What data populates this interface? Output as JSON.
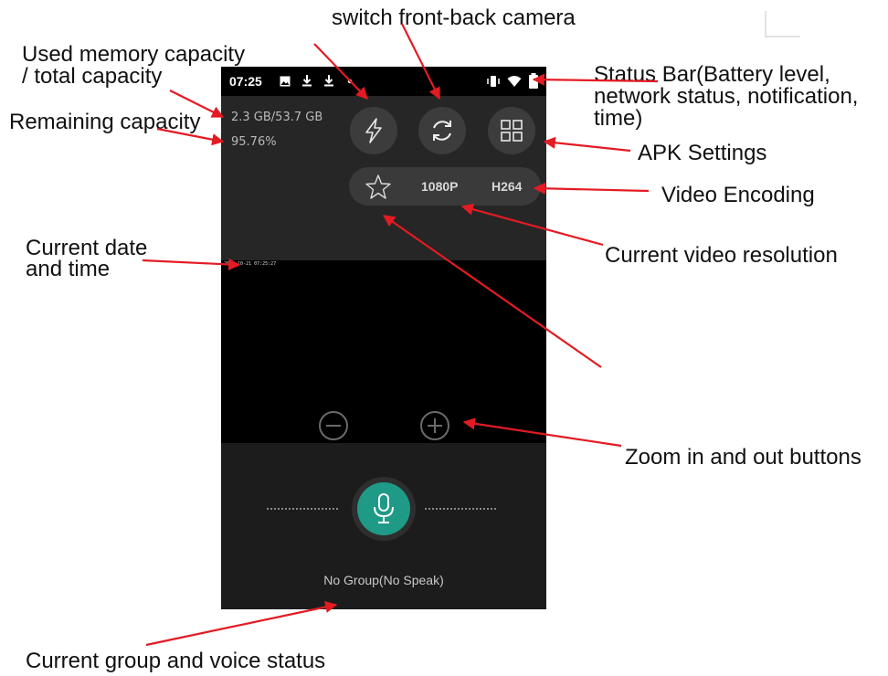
{
  "callouts": {
    "switch_camera": "switch front-back camera",
    "memory_line1": "Used memory capacity",
    "memory_line2": "/ total capacity",
    "remaining": "Remaining capacity",
    "status_line1": "Status Bar(Battery level,",
    "status_line2": "network status, notification,",
    "status_line3": " time)",
    "apk_settings": "APK Settings",
    "video_encoding": "Video Encoding",
    "date_line1": "Current date",
    "date_line2": "and time",
    "resolution": "Current video resolution",
    "zoom": "Zoom in and out buttons",
    "group_voice": "Current group and voice status"
  },
  "phone": {
    "status_time": "07:25",
    "memory_used_total": "2.3 GB/53.7 GB",
    "remaining_percent": "95.76%",
    "resolution": "1080P",
    "encoding": "H264",
    "datetime_overlay": "2024-10-21  07:25:27",
    "group_status": "No Group(No Speak)"
  },
  "icons": [
    "image-icon",
    "download-icon",
    "dot-icon",
    "vibrate-icon",
    "wifi-icon",
    "battery-icon",
    "flash-icon",
    "switch-camera-icon",
    "grid-icon",
    "star-icon",
    "zoom-out-icon",
    "zoom-in-icon",
    "mic-icon"
  ],
  "colors": {
    "arrow": "#e31b23",
    "mic_accent": "#1e9a86",
    "phone_bg": "#141414"
  }
}
